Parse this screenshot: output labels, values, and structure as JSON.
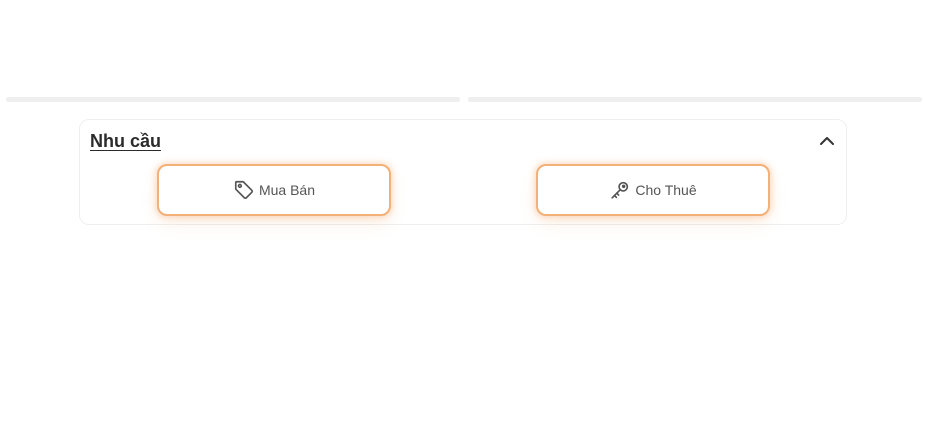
{
  "section": {
    "title": "Nhu cầu",
    "toggle_icon": "chevron-up-icon"
  },
  "options": {
    "buy": {
      "label": "Mua Bán",
      "icon": "tag-icon"
    },
    "rent": {
      "label": "Cho Thuê",
      "icon": "key-icon"
    }
  },
  "colors": {
    "accent_border": "#f3b078",
    "track": "#efefef",
    "text": "#555555",
    "title": "#2b2b2b"
  }
}
